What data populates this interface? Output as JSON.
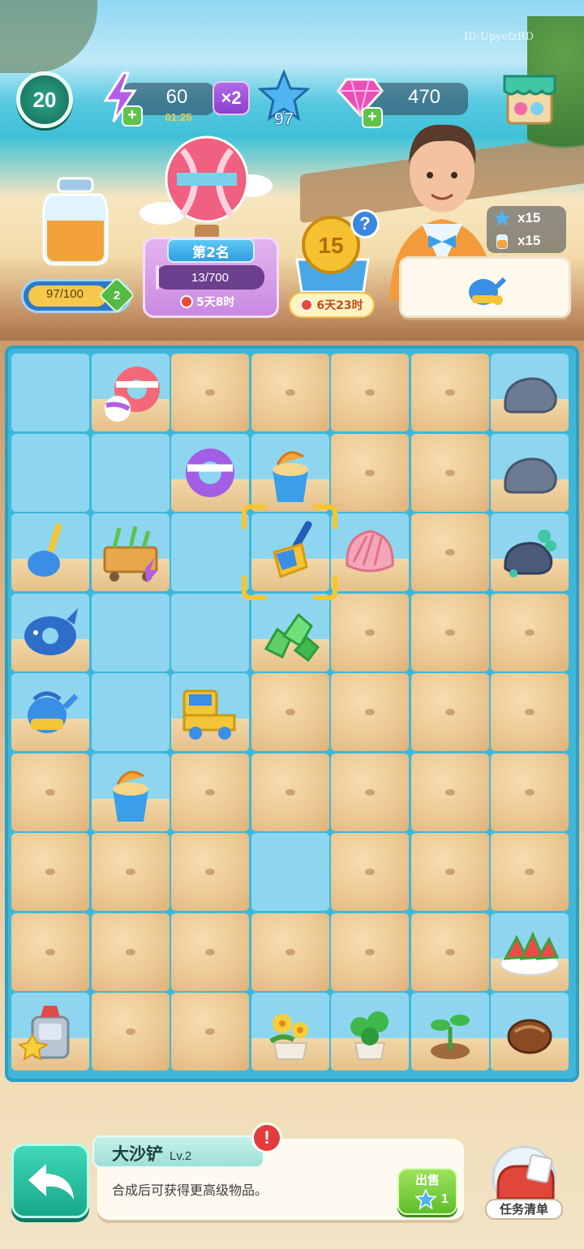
{
  "watermark": "ID:UpyefzRD",
  "header": {
    "player_level": "20",
    "energy": {
      "value": "60",
      "timer": "01:25",
      "multiplier": "×2"
    },
    "stars": "97",
    "gems": "470"
  },
  "jar": {
    "progress_text": "97/100",
    "progress_fraction": 0.97,
    "level": "2"
  },
  "event": {
    "rank": "第2名",
    "progress_text": "13/700",
    "progress_fraction": 0.019,
    "timer": "5天8时"
  },
  "coin_event": {
    "coin_value": "15",
    "help": "?",
    "timer": "6天23时"
  },
  "order": {
    "star_reward": "x15",
    "jar_reward": "x15",
    "item_icon": "watering-can-icon"
  },
  "board": {
    "columns": 7,
    "rows": 9,
    "cells": [
      [
        "water",
        "swim-ring-ball",
        "sand",
        "sand",
        "sand",
        "sand",
        "rock"
      ],
      [
        "water",
        "water",
        "swim-ring-purple",
        "sand-bucket",
        "sand",
        "sand",
        "rock"
      ],
      [
        "shovel-small",
        "toy-cart",
        "water",
        "shovel-big",
        "seashell",
        "sand",
        "rock-coral"
      ],
      [
        "whale-float",
        "water",
        "water",
        "green-stones",
        "sand",
        "sand",
        "sand"
      ],
      [
        "watering-can",
        "water",
        "toy-truck",
        "sand",
        "sand",
        "sand",
        "sand"
      ],
      [
        "sand",
        "sand-bucket",
        "sand",
        "sand",
        "sand",
        "sand",
        "sand"
      ],
      [
        "sand",
        "sand",
        "sand",
        "water",
        "sand",
        "sand",
        "sand"
      ],
      [
        "sand",
        "sand",
        "sand",
        "sand",
        "sand",
        "sand",
        "watermelon-plate"
      ],
      [
        "juicer-machine",
        "sand",
        "sand",
        "flower-pot",
        "clover-pot",
        "sprout",
        "seed"
      ]
    ],
    "selected": {
      "row": 2,
      "col": 3
    }
  },
  "selected_item": {
    "name": "大沙铲",
    "level": "Lv.2",
    "description": "合成后可获得更高级物品。",
    "alert": "!",
    "sell_label": "出售",
    "sell_price": "1"
  },
  "bottom": {
    "task_label": "任务清单"
  },
  "colors": {
    "board": "#3fb7d9",
    "water_cell": "#8ed6ef",
    "sand_cell": "#ecc994",
    "selector": "#f7c531"
  }
}
